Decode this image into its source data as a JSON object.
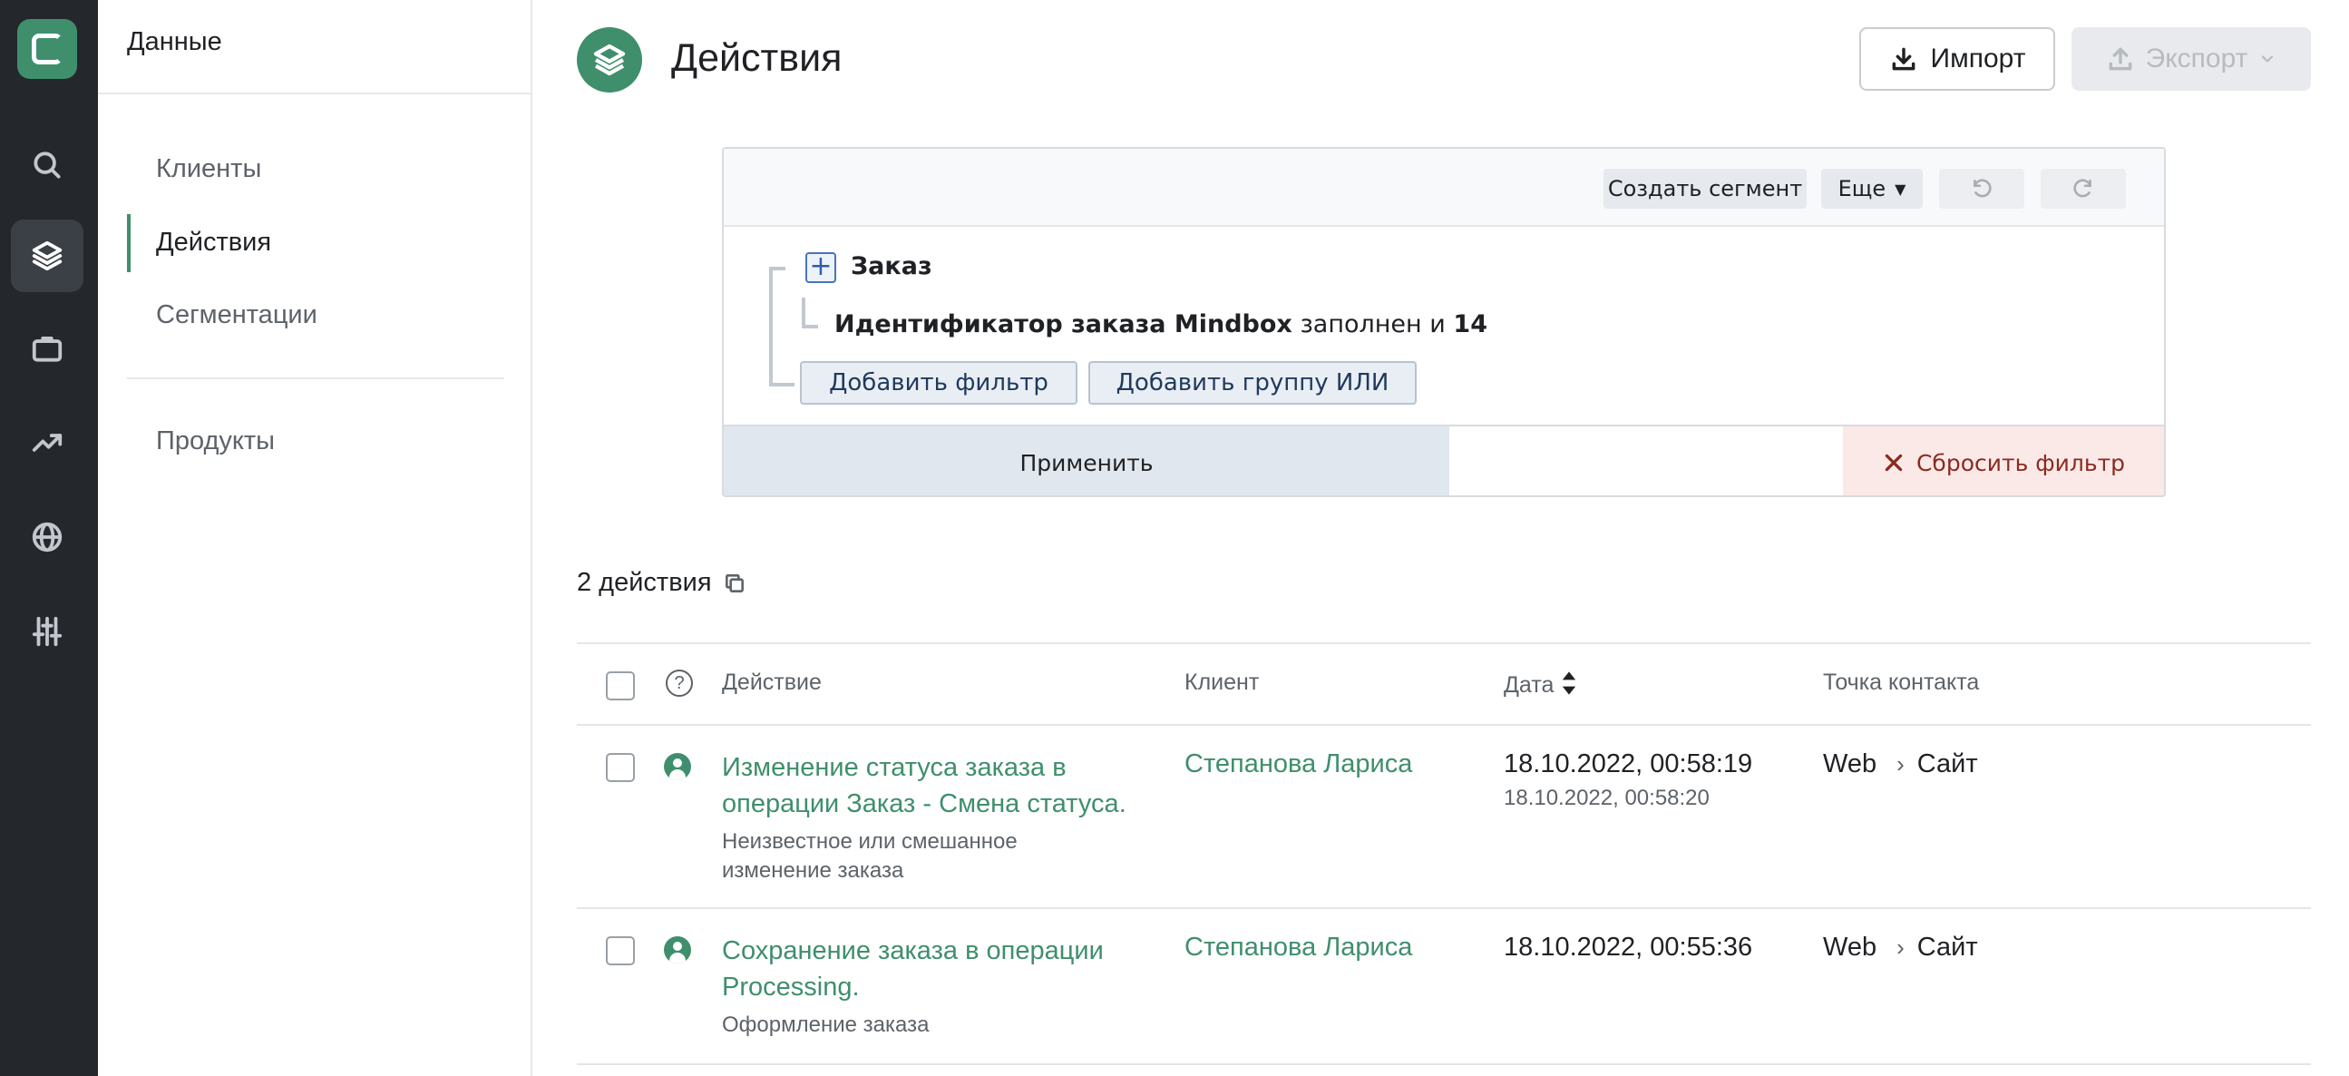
{
  "sidebar": {
    "title": "Данные",
    "items": [
      {
        "label": "Клиенты"
      },
      {
        "label": "Действия"
      },
      {
        "label": "Сегментации"
      },
      {
        "label": "Продукты"
      }
    ],
    "active_index": 1
  },
  "rail": {
    "icons": [
      "logo-icon",
      "search-icon",
      "layers-icon",
      "briefcase-icon",
      "trend-icon",
      "globe-icon",
      "sliders-icon"
    ],
    "active": "layers-icon"
  },
  "header": {
    "title": "Действия",
    "import_label": "Импорт",
    "export_label": "Экспорт"
  },
  "filter": {
    "toolbar": {
      "create_segment": "Создать сегмент",
      "more": "Еще"
    },
    "group_label": "Заказ",
    "condition": {
      "field": "Идентификатор заказа Mindbox",
      "operator": "заполнен и",
      "value": "14"
    },
    "add_filter": "Добавить фильтр",
    "add_or_group": "Добавить группу ИЛИ",
    "apply": "Применить",
    "reset": "Сбросить фильтр"
  },
  "results": {
    "count_text": "2 действия"
  },
  "table": {
    "columns": {
      "action": "Действие",
      "client": "Клиент",
      "date": "Дата",
      "touchpoint": "Точка контакта"
    },
    "rows": [
      {
        "title": "Изменение статуса заказа в операции Заказ - Смена статуса.",
        "subtitle": "Неизвестное или смешанное изменение заказа",
        "client": "Степанова Лариса",
        "date": "18.10.2022, 00:58:19",
        "date_secondary": "18.10.2022, 00:58:20",
        "channel": "Web",
        "point": "Сайт"
      },
      {
        "title": "Сохранение заказа в операции Processing.",
        "subtitle": "Оформление заказа",
        "client": "Степанова Лариса",
        "date": "18.10.2022, 00:55:36",
        "date_secondary": "",
        "channel": "Web",
        "point": "Сайт"
      }
    ]
  },
  "colors": {
    "accent": "#3f8f6c",
    "rail_bg": "#24272c",
    "reset_bg": "#fbe9e7",
    "reset_text": "#8c2a22"
  }
}
